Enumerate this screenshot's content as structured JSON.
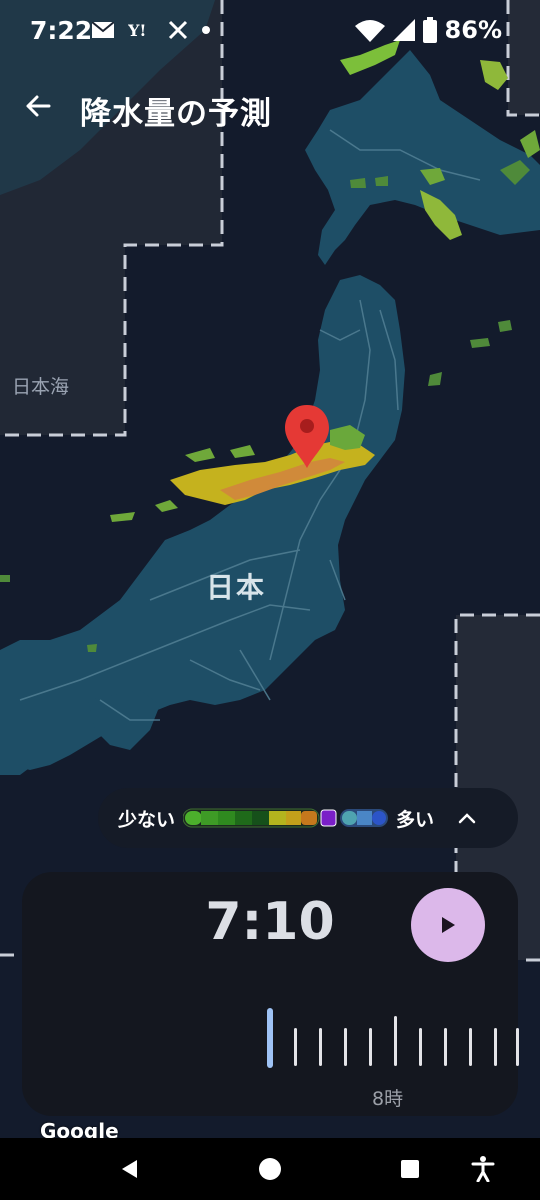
{
  "status": {
    "time": "7:22",
    "battery": "86%"
  },
  "topbar": {
    "title": "降水量の予測"
  },
  "map": {
    "sea_label": "日本海",
    "country_label": "日本"
  },
  "legend": {
    "less_label": "少ない",
    "more_label": "多い",
    "colors": [
      "#4caf2c",
      "#3e9b26",
      "#2f8a1f",
      "#1f6a1a",
      "#b4b41e",
      "#c3a01b",
      "#c5781d",
      "#7a1ec8",
      "#4fa3b0",
      "#4a86c6",
      "#2c55c8"
    ]
  },
  "panel": {
    "time": "7:10",
    "hour_label": "8時",
    "timeline_position": 0
  },
  "attribution": "Google"
}
